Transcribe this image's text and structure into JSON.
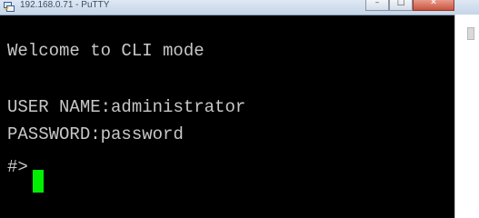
{
  "window": {
    "title": "192.168.0.71 - PuTTY",
    "icon": "putty-icon",
    "controls": [
      "minimize-icon",
      "maximize-icon",
      "close-icon"
    ]
  },
  "terminal": {
    "welcome": "Welcome to CLI mode",
    "user_label": "USER NAME:",
    "user_value": "administrator",
    "password_label": "PASSWORD:",
    "password_value": "password",
    "prompt": "#>",
    "cursor_color": "#00ee00",
    "text_color": "#c8c8c8",
    "background": "#000000"
  }
}
